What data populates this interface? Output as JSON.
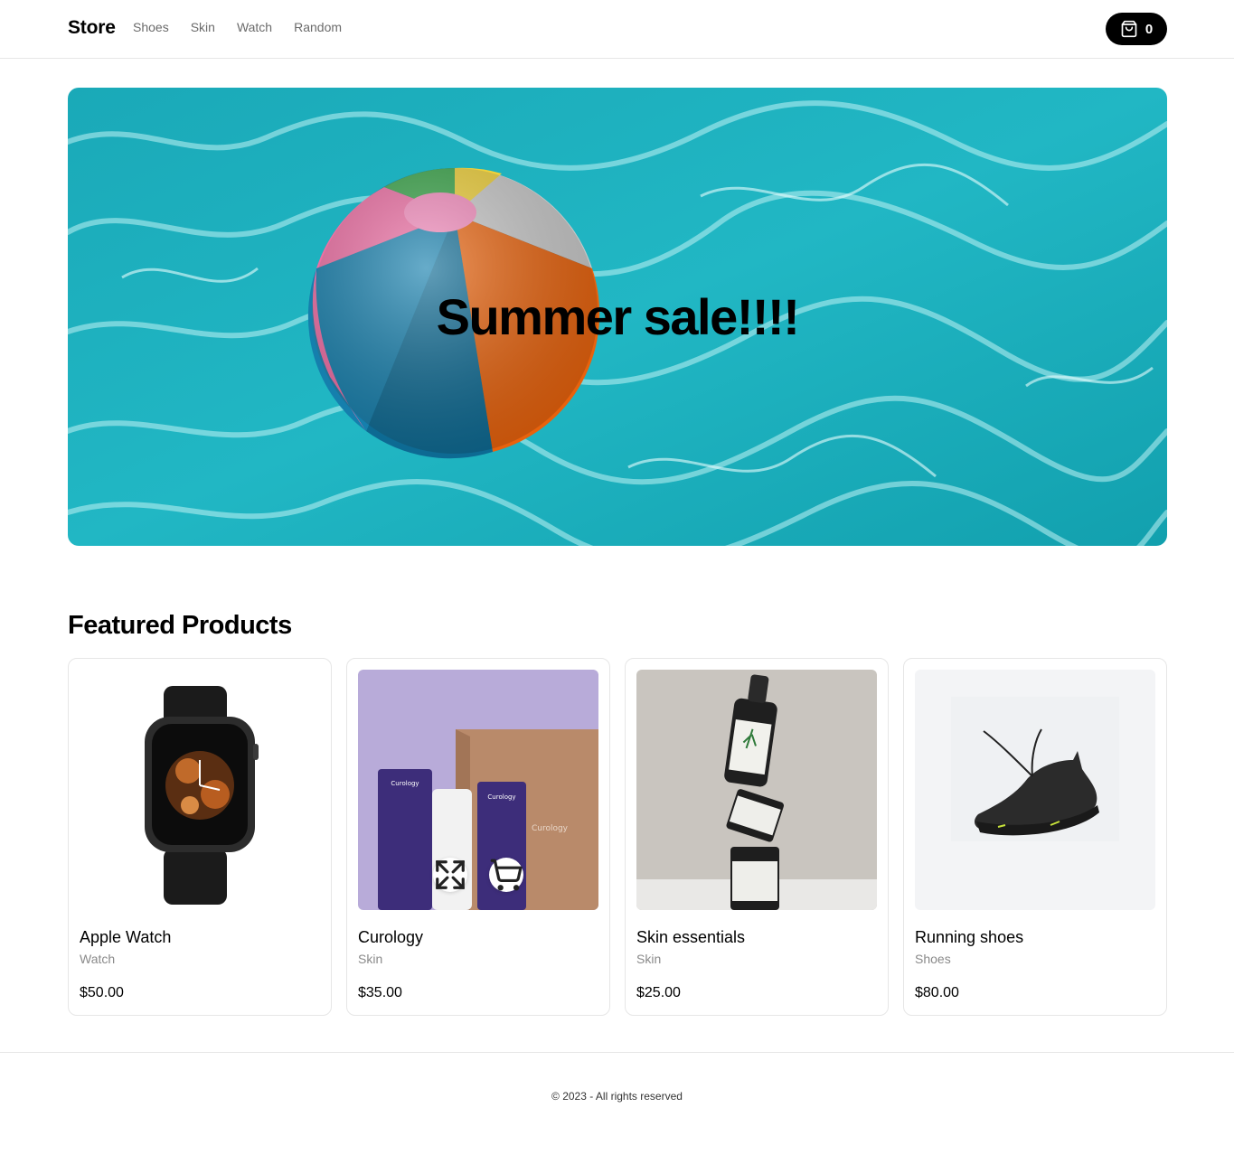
{
  "header": {
    "brand": "Store",
    "nav": [
      "Shoes",
      "Skin",
      "Watch",
      "Random"
    ],
    "cart_count": "0"
  },
  "hero": {
    "title": "Summer sale!!!!"
  },
  "featured": {
    "title": "Featured Products",
    "products": [
      {
        "name": "Apple Watch",
        "category": "Watch",
        "price": "$50.00"
      },
      {
        "name": "Curology",
        "category": "Skin",
        "price": "$35.00"
      },
      {
        "name": "Skin essentials",
        "category": "Skin",
        "price": "$25.00"
      },
      {
        "name": "Running shoes",
        "category": "Shoes",
        "price": "$80.00"
      }
    ]
  },
  "footer": {
    "text": "© 2023 - All rights reserved"
  },
  "icons": {
    "cart": "shopping-bag-icon",
    "expand": "expand-icon",
    "add_to_cart": "cart-icon"
  }
}
